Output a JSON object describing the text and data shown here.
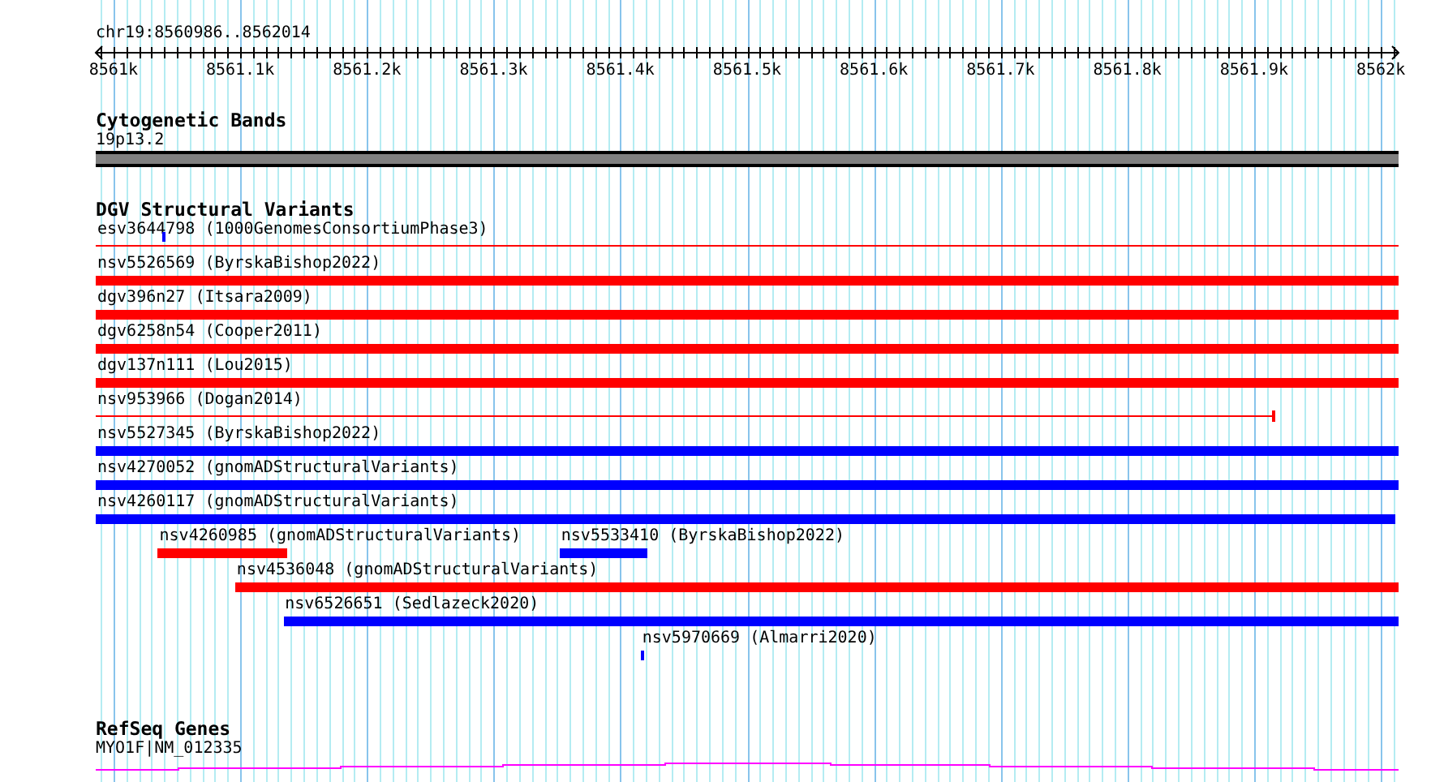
{
  "ruler": {
    "title": "chr19:8560986..8562014",
    "tick_labels": [
      "8561k",
      "8561.1k",
      "8561.2k",
      "8561.3k",
      "8561.4k",
      "8561.5k",
      "8561.6k",
      "8561.7k",
      "8561.8k",
      "8561.9k",
      "8562k"
    ]
  },
  "cytogenetic_bands": {
    "title": "Cytogenetic Bands",
    "band": "19p13.2"
  },
  "dgv": {
    "title": "DGV Structural Variants",
    "variants": [
      {
        "label": "esv3644798 (1000GenomesConsortiumPhase3)",
        "kind": "line",
        "color": "#ff0000"
      },
      {
        "kind": "tick",
        "color": "#0000ff"
      },
      {
        "label": "nsv5526569 (ByrskaBishop2022)",
        "kind": "bar",
        "color": "#ff0000"
      },
      {
        "label": "dgv396n27 (Itsara2009)",
        "kind": "bar",
        "color": "#ff0000"
      },
      {
        "label": "dgv6258n54 (Cooper2011)",
        "kind": "bar",
        "color": "#ff0000"
      },
      {
        "label": "dgv137n111 (Lou2015)",
        "kind": "bar",
        "color": "#ff0000"
      },
      {
        "label": "nsv953966 (Dogan2014)",
        "kind": "line",
        "color": "#ff0000"
      },
      {
        "label": "nsv5527345 (ByrskaBishop2022)",
        "kind": "bar",
        "color": "#0000ff"
      },
      {
        "label": "nsv4270052 (gnomADStructuralVariants)",
        "kind": "bar",
        "color": "#0000ff"
      },
      {
        "label": "nsv4260117 (gnomADStructuralVariants)",
        "kind": "bar",
        "color": "#0000ff"
      },
      {
        "label": "nsv4260985 (gnomADStructuralVariants)",
        "kind": "bar",
        "color": "#ff0000"
      },
      {
        "label": "nsv5533410 (ByrskaBishop2022)",
        "kind": "bar",
        "color": "#0000ff"
      },
      {
        "label": "nsv4536048 (gnomADStructuralVariants)",
        "kind": "bar",
        "color": "#ff0000"
      },
      {
        "label": "nsv6526651 (Sedlazeck2020)",
        "kind": "bar",
        "color": "#0000ff"
      },
      {
        "label": "nsv5970669 (Almarri2020)",
        "kind": "bar",
        "color": "#0000ff"
      }
    ]
  },
  "refseq": {
    "title": "RefSeq Genes",
    "gene": "MYO1F|NM_012335"
  }
}
